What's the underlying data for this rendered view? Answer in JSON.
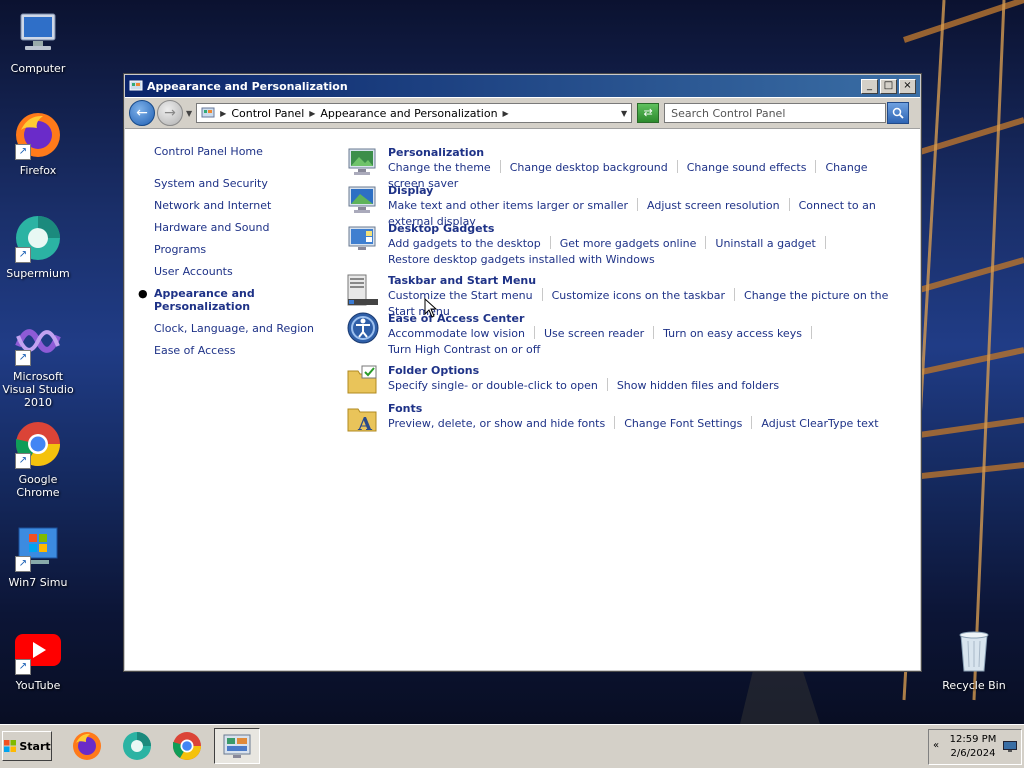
{
  "desktop": {
    "icons": [
      {
        "label": "Computer",
        "icon": "computer-icon"
      },
      {
        "label": "Firefox",
        "icon": "firefox-icon"
      },
      {
        "label": "Supermium",
        "icon": "supermium-icon"
      },
      {
        "label": "Microsoft Visual Studio 2010",
        "icon": "visual-studio-icon"
      },
      {
        "label": "Google Chrome",
        "icon": "chrome-icon"
      },
      {
        "label": "Win7 Simu",
        "icon": "win7-simu-icon"
      },
      {
        "label": "YouTube",
        "icon": "youtube-icon"
      },
      {
        "label": "Recycle Bin",
        "icon": "recycle-bin-icon"
      }
    ]
  },
  "window": {
    "title": "Appearance and Personalization",
    "controls": {
      "minimize": "_",
      "maximize": "□",
      "close": "×"
    },
    "breadcrumb": [
      "Control Panel",
      "Appearance and Personalization"
    ],
    "search_placeholder": "Search Control Panel"
  },
  "sidebar": {
    "home": "Control Panel Home",
    "items": [
      {
        "label": "System and Security"
      },
      {
        "label": "Network and Internet"
      },
      {
        "label": "Hardware and Sound"
      },
      {
        "label": "Programs"
      },
      {
        "label": "User Accounts"
      },
      {
        "label": "Appearance and Personalization",
        "current": true
      },
      {
        "label": "Clock, Language, and Region"
      },
      {
        "label": "Ease of Access"
      }
    ]
  },
  "categories": [
    {
      "title": "Personalization",
      "icon": "personalization-icon",
      "links": [
        "Change the theme",
        "Change desktop background",
        "Change sound effects",
        "Change screen saver"
      ]
    },
    {
      "title": "Display",
      "icon": "display-icon",
      "links": [
        "Make text and other items larger or smaller",
        "Adjust screen resolution",
        "Connect to an external display"
      ]
    },
    {
      "title": "Desktop Gadgets",
      "icon": "desktop-gadgets-icon",
      "links": [
        "Add gadgets to the desktop",
        "Get more gadgets online",
        "Uninstall a gadget",
        "Restore desktop gadgets installed with Windows"
      ]
    },
    {
      "title": "Taskbar and Start Menu",
      "icon": "taskbar-icon",
      "links": [
        "Customize the Start menu",
        "Customize icons on the taskbar",
        "Change the picture on the Start menu"
      ]
    },
    {
      "title": "Ease of Access Center",
      "icon": "ease-of-access-icon",
      "links": [
        "Accommodate low vision",
        "Use screen reader",
        "Turn on easy access keys",
        "Turn High Contrast on or off"
      ]
    },
    {
      "title": "Folder Options",
      "icon": "folder-options-icon",
      "links": [
        "Specify single- or double-click to open",
        "Show hidden files and folders"
      ]
    },
    {
      "title": "Fonts",
      "icon": "fonts-icon",
      "links": [
        "Preview, delete, or show and hide fonts",
        "Change Font Settings",
        "Adjust ClearType text"
      ]
    }
  ],
  "taskbar": {
    "start_label": "Start",
    "apps": [
      "firefox-icon",
      "supermium-icon",
      "chrome-icon",
      "control-panel-icon"
    ],
    "time": "12:59 PM",
    "date": "2/6/2024"
  }
}
